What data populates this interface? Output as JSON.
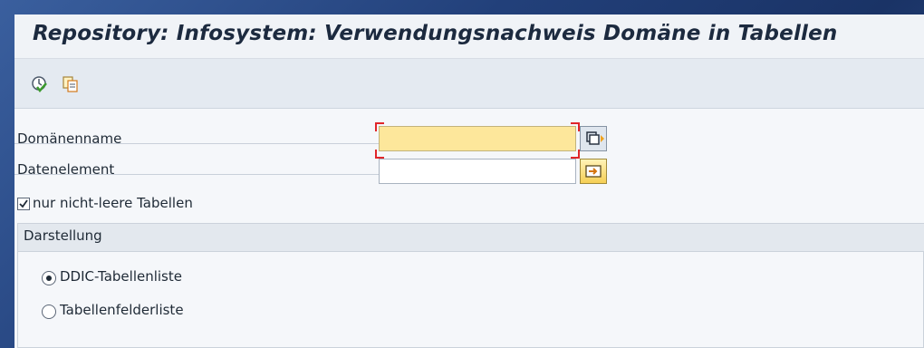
{
  "window": {
    "title": "Repository: Infosystem: Verwendungsnachweis Domäne in Tabellen"
  },
  "toolbar": {
    "buttons": [
      {
        "icon": "execute-icon"
      },
      {
        "icon": "copy-icon"
      }
    ]
  },
  "form": {
    "fields": [
      {
        "label": "Domänenname",
        "value": "",
        "required": true,
        "focused": true,
        "button_icon": "multiple-selection-icon"
      },
      {
        "label": "Datenelement",
        "value": "",
        "required": false,
        "button_icon": "multiple-selection-arrow-icon"
      }
    ],
    "checkbox": {
      "label": "nur nicht-leere Tabellen",
      "checked": true
    }
  },
  "darstellung": {
    "title": "Darstellung",
    "options": [
      {
        "label": "DDIC-Tabellenliste",
        "selected": true
      },
      {
        "label": "Tabellenfelderliste",
        "selected": false
      }
    ]
  },
  "colors": {
    "required_field": "#fde79b",
    "background_gradient_start": "#3a5f9e",
    "background_gradient_end": "#1a3366"
  }
}
